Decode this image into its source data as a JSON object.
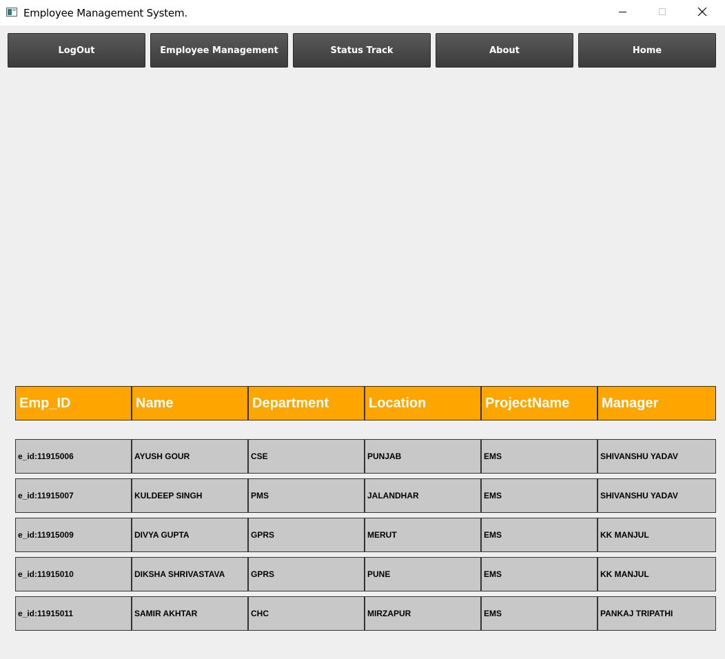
{
  "window": {
    "title": "Employee Management System.",
    "icons": [
      "app-icon",
      "minimize-icon",
      "maximize-icon",
      "close-icon"
    ]
  },
  "nav": {
    "buttons": [
      "LogOut",
      "Employee Management",
      "Status Track",
      "About",
      "Home"
    ]
  },
  "table": {
    "headers": [
      "Emp_ID",
      "Name",
      "Department",
      "Location",
      "ProjectName",
      "Manager"
    ],
    "rows": [
      [
        "e_id:11915006",
        "AYUSH GOUR",
        "CSE",
        "PUNJAB",
        "EMS",
        "SHIVANSHU YADAV"
      ],
      [
        "e_id:11915007",
        "KULDEEP SINGH",
        "PMS",
        "JALANDHAR",
        "EMS",
        "SHIVANSHU YADAV"
      ],
      [
        "e_id:11915009",
        "DIVYA GUPTA",
        "GPRS",
        "MERUT",
        "EMS",
        "KK MANJUL"
      ],
      [
        "e_id:11915010",
        "DIKSHA SHRIVASTAVA",
        "GPRS",
        "PUNE",
        "EMS",
        "KK MANJUL"
      ],
      [
        "e_id:11915011",
        "SAMIR AKHTAR",
        "CHC",
        "MIRZAPUR",
        "EMS",
        "PANKAJ TRIPATHI"
      ]
    ]
  },
  "colors": {
    "header_bg": "#ffa500",
    "row_bg": "#c8c8c8",
    "nav_bg": "#454545",
    "window_bg": "#efefef"
  }
}
